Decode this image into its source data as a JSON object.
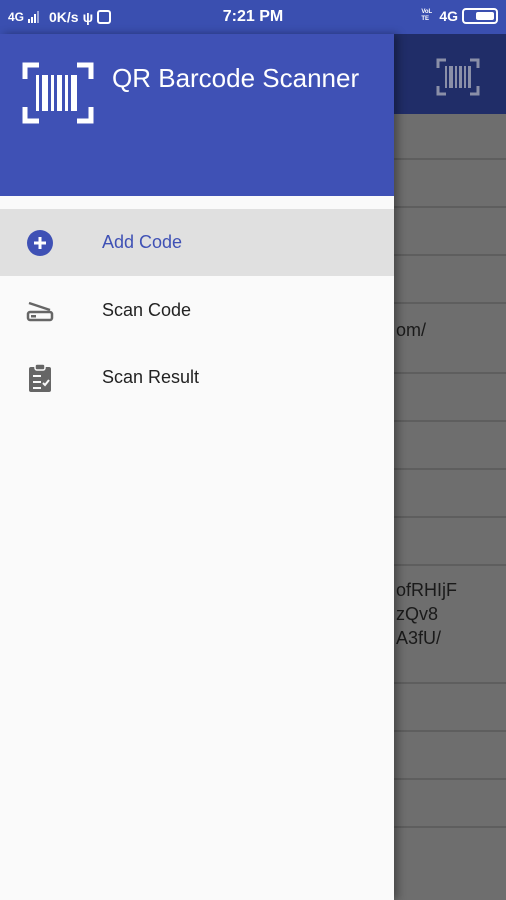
{
  "status_bar": {
    "network_left": "4G",
    "speed": "0K/s",
    "time": "7:21 PM",
    "network_right": "4G",
    "network_small": "VoLTE"
  },
  "drawer": {
    "title": "QR Barcode Scanner",
    "menu": [
      {
        "label": "Add Code",
        "icon": "add-circle-icon",
        "selected": true
      },
      {
        "label": "Scan Code",
        "icon": "scanner-icon",
        "selected": false
      },
      {
        "label": "Scan Result",
        "icon": "clipboard-check-icon",
        "selected": false
      }
    ]
  },
  "background": {
    "snippets": [
      "om/",
      "ofRHIjF",
      "zQv8",
      "A3fU/"
    ]
  },
  "colors": {
    "primary": "#3f51b5",
    "status_bar": "#3a4fb0",
    "selected_bg": "#e0e0e0"
  }
}
